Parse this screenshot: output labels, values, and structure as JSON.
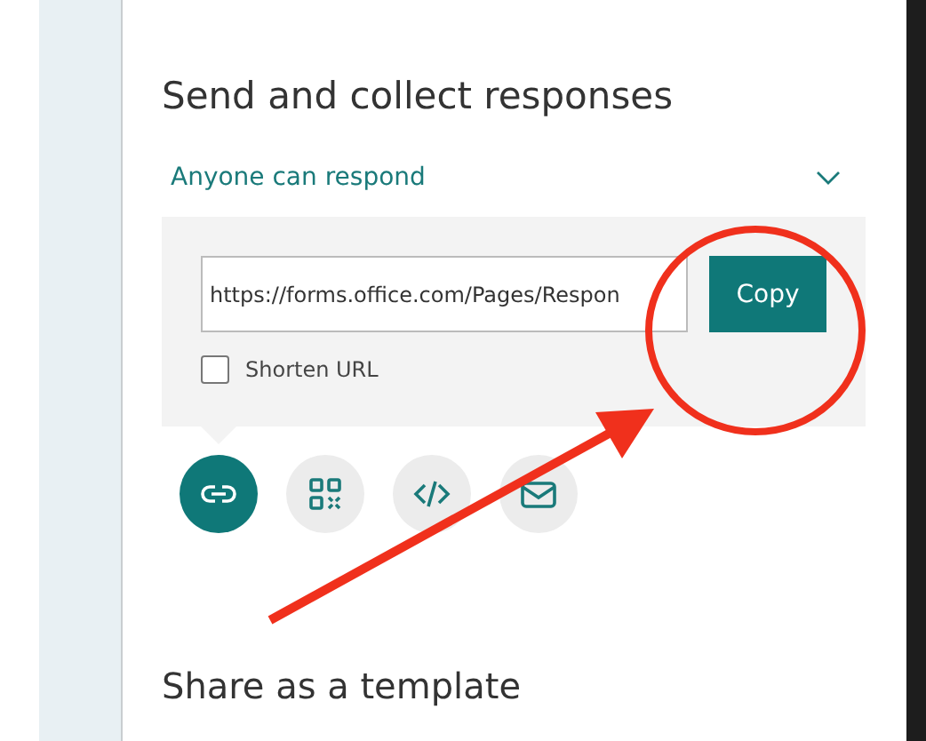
{
  "heading": "Send and collect responses",
  "audience": {
    "label": "Anyone can respond"
  },
  "link": {
    "url": "https://forms.office.com/Pages/Respon",
    "copy_label": "Copy"
  },
  "shorten_url": {
    "label": "Shorten URL",
    "checked": false
  },
  "share_options": [
    {
      "kind": "link",
      "selected": true
    },
    {
      "kind": "qr",
      "selected": false
    },
    {
      "kind": "embed",
      "selected": false
    },
    {
      "kind": "email",
      "selected": false
    }
  ],
  "template_heading": "Share as a template"
}
